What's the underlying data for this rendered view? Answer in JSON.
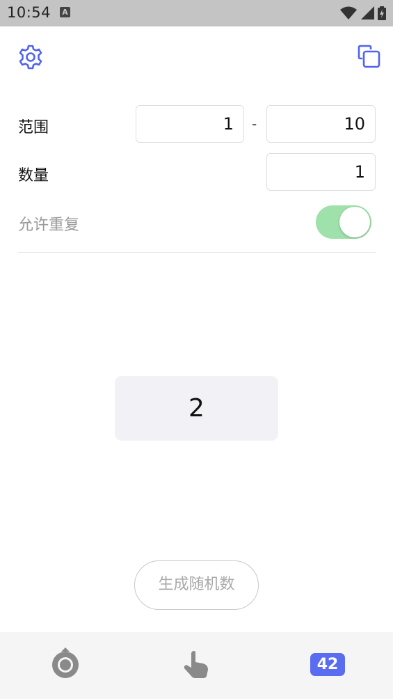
{
  "status_bar": {
    "time": "10:54",
    "notification_icon": "a-letter-icon",
    "icons": [
      "wifi-icon",
      "signal-icon",
      "battery-charging-icon"
    ]
  },
  "toolbar": {
    "settings_icon": "gear-icon",
    "copy_icon": "copy-icon"
  },
  "form": {
    "range_label": "范围",
    "range_min": "1",
    "range_separator": "-",
    "range_max": "10",
    "count_label": "数量",
    "count_value": "1",
    "repeat_label": "允许重复",
    "repeat_enabled": true
  },
  "result": {
    "value": "2"
  },
  "actions": {
    "generate_label": "生成随机数"
  },
  "bottom_bar": {
    "badge_text": "42",
    "icons": [
      "record-circle-icon",
      "pointing-hand-icon"
    ]
  },
  "colors": {
    "accent": "#4f63f0",
    "toggle_on": "#9fe1aa",
    "badge": "#5a6cf0",
    "result_bg": "#f2f2f6"
  }
}
